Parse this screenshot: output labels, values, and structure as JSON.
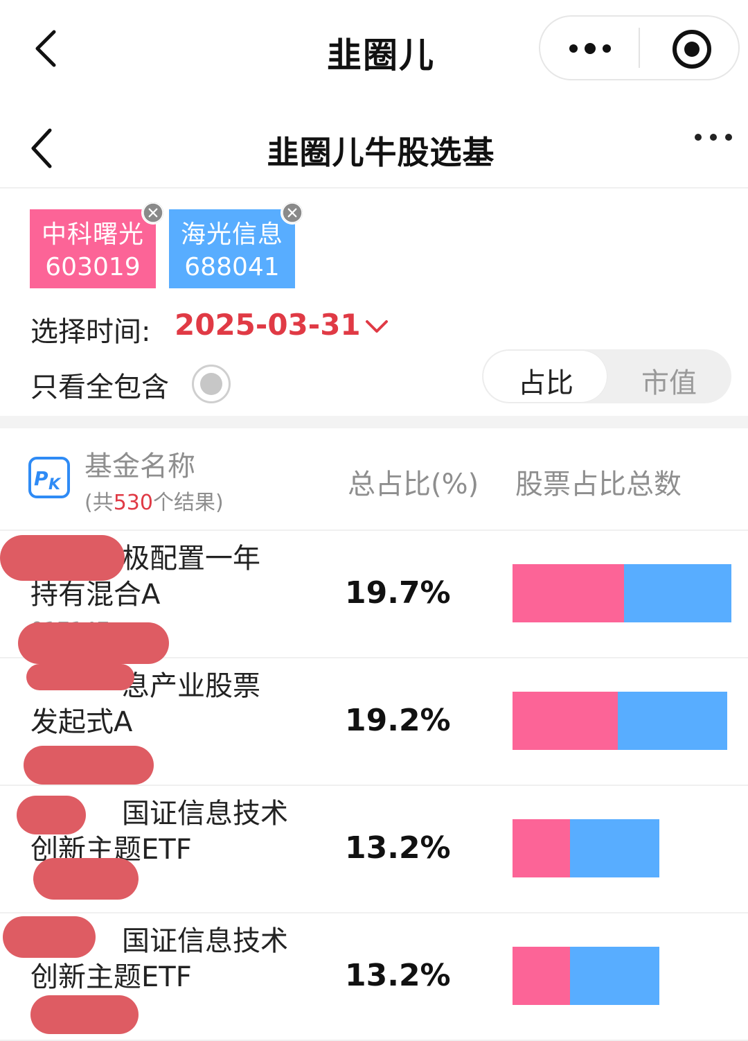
{
  "app_bar": {
    "title": "韭圈儿"
  },
  "page": {
    "title": "韭圈儿牛股选基"
  },
  "stocks": [
    {
      "name": "中科曙光",
      "code": "603019",
      "color": "#fc6497"
    },
    {
      "name": "海光信息",
      "code": "688041",
      "color": "#58adff"
    }
  ],
  "filter": {
    "time_label": "选择时间:",
    "date": "2025-03-31",
    "full_include_label": "只看全包含"
  },
  "toggle": {
    "options": [
      "占比",
      "市值"
    ],
    "selected": "占比"
  },
  "table": {
    "col_name": "基金名称",
    "result_prefix": "(共",
    "result_count": "530",
    "result_suffix": "个结果)",
    "col_total": "总占比(%)",
    "col_bar": "股票占比总数",
    "rows": [
      {
        "name_line1": "极配置一年",
        "name_line2": "持有混合A",
        "code": "017147",
        "total": "19.7%",
        "share_pink": 0.51,
        "share_blue": 0.49,
        "bar_scale": 1.0
      },
      {
        "name_line1": "息产业股票",
        "name_line2": "发起式A",
        "code": "",
        "total": "19.2%",
        "share_pink": 0.49,
        "share_blue": 0.51,
        "bar_scale": 0.98
      },
      {
        "name_line1": "国证信息技术",
        "name_line2": "创新主题ETF",
        "code": "",
        "total": "13.2%",
        "share_pink": 0.39,
        "share_blue": 0.61,
        "bar_scale": 0.67
      },
      {
        "name_line1": "国证信息技术",
        "name_line2": "创新主题ETF",
        "code": "",
        "total": "13.2%",
        "share_pink": 0.39,
        "share_blue": 0.61,
        "bar_scale": 0.67
      }
    ]
  }
}
